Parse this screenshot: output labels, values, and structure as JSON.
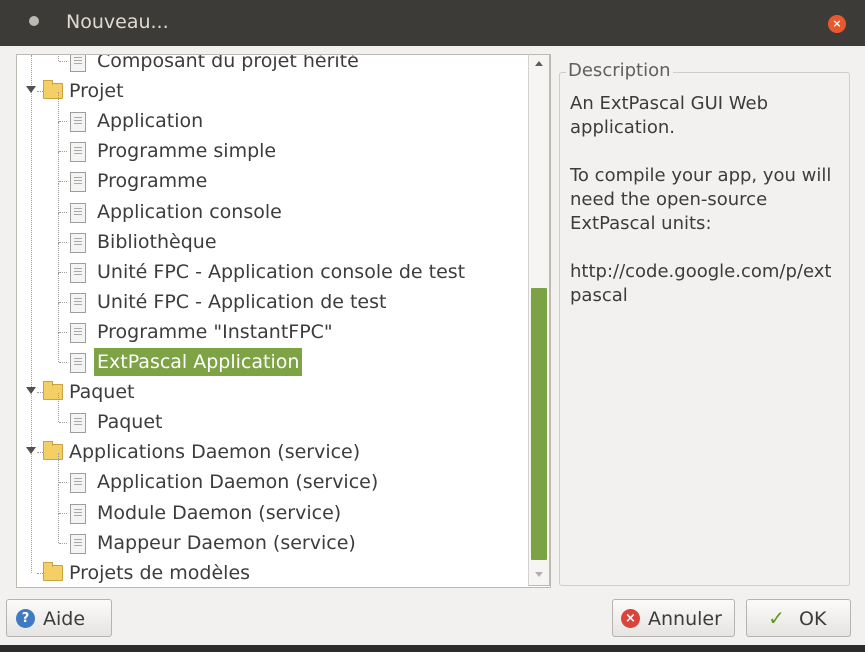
{
  "window": {
    "title": "Nouveau...",
    "close_glyph": "×"
  },
  "tree": {
    "items": [
      {
        "label": "Composant du projet hérité",
        "type": "file",
        "level": 1
      },
      {
        "label": "Projet",
        "type": "folder",
        "level": 0,
        "expanded": true
      },
      {
        "label": "Application",
        "type": "file",
        "level": 1
      },
      {
        "label": "Programme simple",
        "type": "file",
        "level": 1
      },
      {
        "label": "Programme",
        "type": "file",
        "level": 1
      },
      {
        "label": "Application console",
        "type": "file",
        "level": 1
      },
      {
        "label": "Bibliothèque",
        "type": "file",
        "level": 1
      },
      {
        "label": "Unité FPC - Application console de test",
        "type": "file",
        "level": 1
      },
      {
        "label": "Unité FPC - Application de test",
        "type": "file",
        "level": 1
      },
      {
        "label": "Programme \"InstantFPC\"",
        "type": "file",
        "level": 1
      },
      {
        "label": "ExtPascal Application",
        "type": "file",
        "level": 1,
        "selected": true
      },
      {
        "label": "Paquet",
        "type": "folder",
        "level": 0,
        "expanded": true
      },
      {
        "label": "Paquet",
        "type": "file",
        "level": 1
      },
      {
        "label": "Applications Daemon (service)",
        "type": "folder",
        "level": 0,
        "expanded": true
      },
      {
        "label": "Application Daemon (service)",
        "type": "file",
        "level": 1
      },
      {
        "label": "Module Daemon (service)",
        "type": "file",
        "level": 1
      },
      {
        "label": "Mappeur Daemon (service)",
        "type": "file",
        "level": 1
      },
      {
        "label": "Projets de modèles",
        "type": "folder",
        "level": 0,
        "expanded": false
      }
    ]
  },
  "description": {
    "legend": "Description",
    "paragraphs": [
      "An ExtPascal GUI Web application.",
      "To compile your app, you will need the open-source ExtPascal units:",
      "http://code.google.com/p/extpascal"
    ]
  },
  "buttons": {
    "help": {
      "label": "Aide",
      "icon": "help-icon",
      "glyph": "?"
    },
    "cancel": {
      "label": "Annuler",
      "icon": "cancel-icon",
      "glyph": "×"
    },
    "ok": {
      "label": "OK",
      "icon": "checkmark-icon",
      "glyph": "✓"
    }
  },
  "colors": {
    "selection": "#7ea344",
    "titlebar": "#3c3b37",
    "close": "#e9592d"
  }
}
